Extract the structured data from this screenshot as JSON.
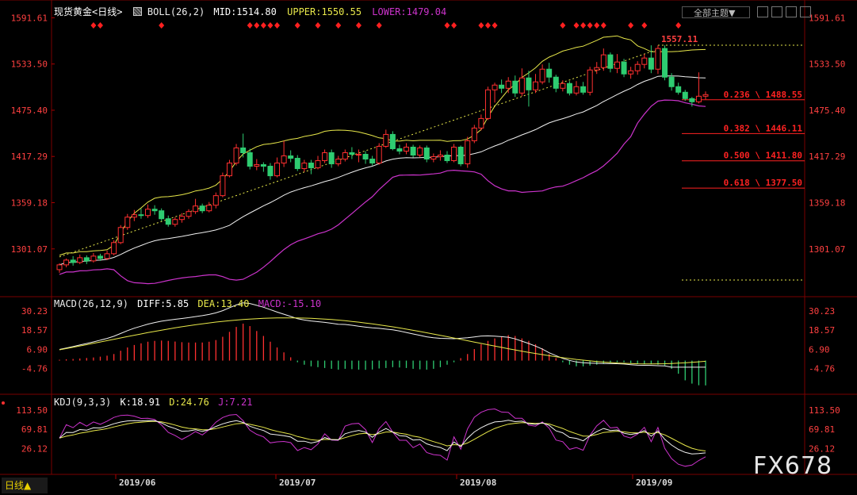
{
  "header": {
    "symbol": "现货黄金<日线>",
    "boll_label": "BOLL(26,2)",
    "mid": "MID:1514.80",
    "upper": "UPPER:1550.55",
    "lower": "LOWER:1479.04",
    "theme_button": "全部主题▼"
  },
  "macd_header": {
    "label": "MACD(26,12,9)",
    "diff": "DIFF:5.85",
    "dea": "DEA:13.40",
    "macd": "MACD:-15.10"
  },
  "kdj_header": {
    "label": "KDJ(9,3,3)",
    "k": "K:18.91",
    "d": "D:24.76",
    "j": "J:7.21"
  },
  "tab_label": "日线▲",
  "watermark": "FX678",
  "colors": {
    "up": "#ff3030",
    "down": "#2ecc71",
    "mid": "#f0f0f0",
    "upper": "#e8e84a",
    "lower": "#cc33cc",
    "fib": "#ff2222"
  },
  "chart_data": {
    "type": "candlestick",
    "title": "现货黄金<日线>",
    "price_axis": {
      "ticks": [
        "1591.61",
        "1533.50",
        "1475.40",
        "1417.29",
        "1359.18",
        "1301.07"
      ],
      "ylim": [
        1243,
        1600
      ]
    },
    "date_axis": [
      "2019/06",
      "2019/07",
      "2019/08",
      "2019/09"
    ],
    "annotations": {
      "high_label": "1557.11"
    },
    "fibonacci": [
      {
        "label": "0.236 \\ 1488.55",
        "value": 1488.55
      },
      {
        "label": "0.382 \\ 1446.11",
        "value": 1446.11
      },
      {
        "label": "0.500 \\ 1411.80",
        "value": 1411.8
      },
      {
        "label": "0.618 \\ 1377.50",
        "value": 1377.5
      }
    ],
    "candles": [
      [
        1275,
        1281,
        1271,
        1283
      ],
      [
        1281,
        1287,
        1278,
        1289
      ],
      [
        1287,
        1284,
        1280,
        1292
      ],
      [
        1284,
        1290,
        1282,
        1294
      ],
      [
        1290,
        1286,
        1282,
        1293
      ],
      [
        1286,
        1292,
        1284,
        1296
      ],
      [
        1292,
        1289,
        1286,
        1295
      ],
      [
        1289,
        1295,
        1287,
        1299
      ],
      [
        1295,
        1309,
        1293,
        1312
      ],
      [
        1309,
        1328,
        1307,
        1331
      ],
      [
        1328,
        1341,
        1325,
        1345
      ],
      [
        1341,
        1344,
        1336,
        1350
      ],
      [
        1344,
        1343,
        1339,
        1352
      ],
      [
        1343,
        1351,
        1340,
        1357
      ],
      [
        1351,
        1349,
        1344,
        1356
      ],
      [
        1349,
        1339,
        1336,
        1352
      ],
      [
        1339,
        1332,
        1329,
        1343
      ],
      [
        1332,
        1338,
        1329,
        1341
      ],
      [
        1338,
        1342,
        1334,
        1346
      ],
      [
        1342,
        1348,
        1339,
        1351
      ],
      [
        1348,
        1355,
        1345,
        1364
      ],
      [
        1355,
        1349,
        1346,
        1358
      ],
      [
        1349,
        1356,
        1347,
        1360
      ],
      [
        1356,
        1368,
        1352,
        1372
      ],
      [
        1368,
        1393,
        1366,
        1397
      ],
      [
        1393,
        1409,
        1391,
        1413
      ],
      [
        1409,
        1428,
        1406,
        1433
      ],
      [
        1428,
        1422,
        1416,
        1446
      ],
      [
        1422,
        1405,
        1401,
        1427
      ],
      [
        1405,
        1407,
        1400,
        1414
      ],
      [
        1407,
        1405,
        1398,
        1410
      ],
      [
        1405,
        1393,
        1388,
        1409
      ],
      [
        1393,
        1409,
        1391,
        1416
      ],
      [
        1409,
        1418,
        1404,
        1437
      ],
      [
        1418,
        1415,
        1410,
        1425
      ],
      [
        1415,
        1402,
        1399,
        1419
      ],
      [
        1402,
        1409,
        1398,
        1413
      ],
      [
        1409,
        1403,
        1395,
        1413
      ],
      [
        1403,
        1412,
        1401,
        1418
      ],
      [
        1412,
        1422,
        1409,
        1426
      ],
      [
        1422,
        1408,
        1403,
        1426
      ],
      [
        1408,
        1414,
        1405,
        1418
      ],
      [
        1414,
        1422,
        1411,
        1426
      ],
      [
        1422,
        1420,
        1414,
        1429
      ],
      [
        1420,
        1420,
        1410,
        1426
      ],
      [
        1420,
        1414,
        1408,
        1424
      ],
      [
        1414,
        1409,
        1406,
        1418
      ],
      [
        1409,
        1430,
        1407,
        1434
      ],
      [
        1430,
        1445,
        1428,
        1451
      ],
      [
        1445,
        1427,
        1425,
        1449
      ],
      [
        1427,
        1424,
        1420,
        1432
      ],
      [
        1424,
        1429,
        1420,
        1434
      ],
      [
        1429,
        1419,
        1416,
        1432
      ],
      [
        1419,
        1428,
        1416,
        1431
      ],
      [
        1428,
        1414,
        1410,
        1431
      ],
      [
        1414,
        1417,
        1410,
        1421
      ],
      [
        1417,
        1419,
        1412,
        1425
      ],
      [
        1419,
        1412,
        1409,
        1424
      ],
      [
        1412,
        1429,
        1410,
        1433
      ],
      [
        1429,
        1408,
        1405,
        1431
      ],
      [
        1408,
        1437,
        1403,
        1442
      ],
      [
        1437,
        1453,
        1434,
        1457
      ],
      [
        1453,
        1465,
        1450,
        1470
      ],
      [
        1465,
        1501,
        1463,
        1505
      ],
      [
        1501,
        1507,
        1485,
        1510
      ],
      [
        1507,
        1503,
        1497,
        1514
      ],
      [
        1503,
        1512,
        1497,
        1517
      ],
      [
        1512,
        1497,
        1492,
        1519
      ],
      [
        1497,
        1516,
        1493,
        1528
      ],
      [
        1516,
        1501,
        1480,
        1525
      ],
      [
        1501,
        1511,
        1497,
        1521
      ],
      [
        1511,
        1527,
        1508,
        1533
      ],
      [
        1527,
        1517,
        1510,
        1535
      ],
      [
        1517,
        1503,
        1498,
        1520
      ],
      [
        1503,
        1509,
        1499,
        1513
      ],
      [
        1509,
        1497,
        1494,
        1512
      ],
      [
        1497,
        1505,
        1494,
        1512
      ],
      [
        1505,
        1498,
        1495,
        1511
      ],
      [
        1498,
        1526,
        1494,
        1530
      ],
      [
        1526,
        1529,
        1521,
        1536
      ],
      [
        1529,
        1545,
        1525,
        1553
      ],
      [
        1545,
        1528,
        1523,
        1548
      ],
      [
        1528,
        1536,
        1522,
        1546
      ],
      [
        1536,
        1521,
        1517,
        1540
      ],
      [
        1521,
        1525,
        1515,
        1530
      ],
      [
        1525,
        1533,
        1520,
        1537
      ],
      [
        1533,
        1541,
        1528,
        1546
      ],
      [
        1541,
        1527,
        1522,
        1557
      ],
      [
        1527,
        1553,
        1521,
        1557
      ],
      [
        1553,
        1517,
        1513,
        1557
      ],
      [
        1517,
        1505,
        1500,
        1522
      ],
      [
        1505,
        1498,
        1495,
        1510
      ],
      [
        1498,
        1490,
        1487,
        1501
      ],
      [
        1490,
        1486,
        1480,
        1492
      ],
      [
        1486,
        1493,
        1484,
        1523
      ],
      [
        1493,
        1495,
        1489,
        1499
      ]
    ],
    "macd_axis": {
      "ticks": [
        "30.23",
        "18.57",
        "6.90",
        "-4.76"
      ],
      "ylim": [
        -20,
        36
      ]
    },
    "macd_hist": [
      0.5,
      0.8,
      1.0,
      1.3,
      1.6,
      1.9,
      2.4,
      3.0,
      4.0,
      6.0,
      8.0,
      9.5,
      10.5,
      11.5,
      12.0,
      12.2,
      12.0,
      11.6,
      11.2,
      11.0,
      11.0,
      11.0,
      11.5,
      12.5,
      14.5,
      17.5,
      20.5,
      22.5,
      21.0,
      18.0,
      15.0,
      11.5,
      8.0,
      5.0,
      2.0,
      -1.0,
      -2.5,
      -3.5,
      -4.0,
      -4.5,
      -5.0,
      -5.5,
      -5.0,
      -5.2,
      -5.5,
      -5.6,
      -5.4,
      -4.8,
      -4.5,
      -4.0,
      -4.2,
      -4.5,
      -5.0,
      -5.3,
      -5.5,
      -5.0,
      -4.0,
      -2.5,
      -1.0,
      1.5,
      4.0,
      7.0,
      10.0,
      12.0,
      13.5,
      14.5,
      15.5,
      15.0,
      13.5,
      12.0,
      10.0,
      7.5,
      4.0,
      1.5,
      -1.0,
      -2.5,
      -3.5,
      -3.5,
      -3.0,
      -2.5,
      -2.0,
      -1.5,
      -1.0,
      -1.0,
      -1.5,
      -2.0,
      -2.0,
      -2.0,
      -2.5,
      -3.0,
      -5.0,
      -8.0,
      -12.0,
      -14.0,
      -15.0,
      -15.1
    ],
    "kdj_axis": {
      "ticks": [
        "113.50",
        "69.81",
        "26.12"
      ],
      "ylim": [
        -30,
        140
      ]
    },
    "kdj": {
      "k_last": 18.91,
      "d_last": 24.76,
      "j_last": 7.21
    }
  }
}
